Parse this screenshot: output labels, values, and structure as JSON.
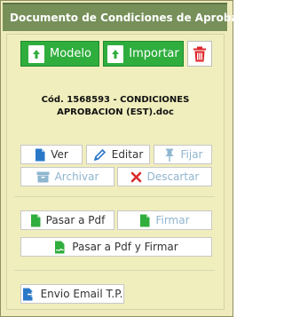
{
  "panel": {
    "title": "Documento de Condiciones de Aprobación"
  },
  "toolbar": {
    "modelo_label": "Modelo",
    "importar_label": "Importar"
  },
  "document": {
    "line1": "Cód. 1568593 - CONDICIONES",
    "line2": "APROBACION (EST).doc"
  },
  "actions": {
    "ver": "Ver",
    "editar": "Editar",
    "fijar": "Fijar",
    "archivar": "Archivar",
    "descartar": "Descartar",
    "pasar_pdf": "Pasar a Pdf",
    "firmar": "Firmar",
    "pasar_pdf_firmar": "Pasar a Pdf y Firmar",
    "envio_email": "Envio Email T.P."
  },
  "colors": {
    "header": "#77905a",
    "panel_bg": "#efebbd",
    "primary_green": "#2fae3e",
    "delete_red": "#e0262a",
    "enabled_icon": "#2a78c8",
    "disabled_text": "#8fb6cf"
  },
  "icons": {
    "modelo": "upload-file-icon",
    "importar": "upload-file-icon",
    "delete": "trash-icon",
    "ver": "document-icon",
    "editar": "pencil-icon",
    "fijar": "pin-icon",
    "archivar": "archive-icon",
    "descartar": "x-icon",
    "pasar_pdf": "pdf-file-icon",
    "firmar": "pdf-file-icon",
    "pasar_pdf_firmar": "signed-pdf-icon",
    "envio_email": "send-document-icon"
  }
}
